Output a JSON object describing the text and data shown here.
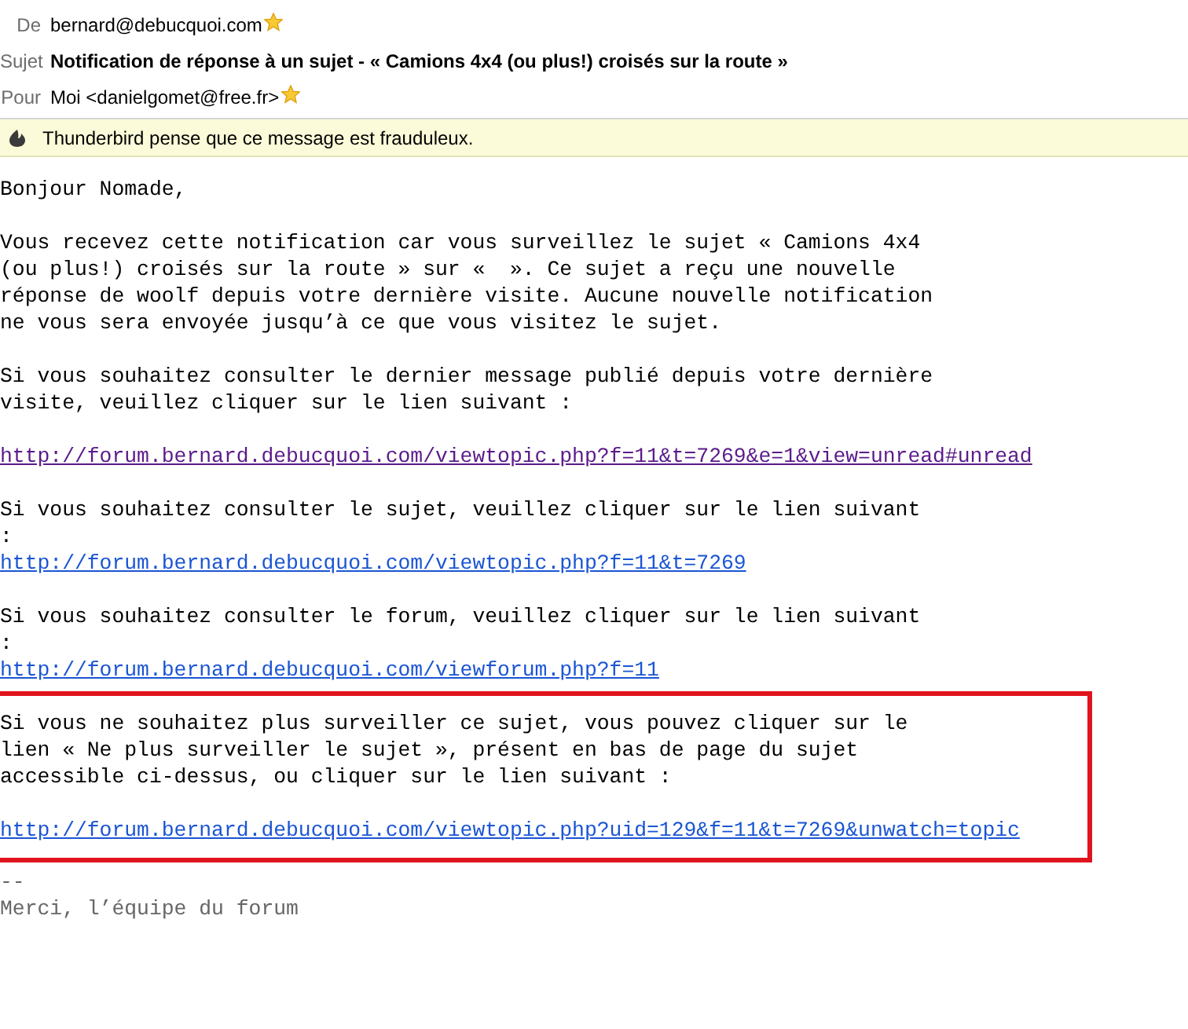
{
  "header": [
    {
      "label": "De",
      "value": "bernard@debucquoi.com",
      "bold": false,
      "starred": true
    },
    {
      "label": "Sujet",
      "value": "Notification de réponse à un sujet - « Camions 4x4 (ou plus!) croisés sur la route »",
      "bold": true,
      "starred": false
    },
    {
      "label": "Pour",
      "value": "Moi <danielgomet@free.fr>",
      "bold": false,
      "starred": true
    }
  ],
  "notification": {
    "text": "Thunderbird pense que ce message est frauduleux."
  },
  "body": [
    {
      "kind": "plain",
      "parts": [
        {
          "kind": "paragraph",
          "text": "Bonjour Nomade,"
        }
      ]
    },
    {
      "kind": "plain",
      "parts": [
        {
          "kind": "paragraph",
          "text": "Vous recevez cette notification car vous surveillez le sujet « Camions 4x4\n(ou plus!) croisés sur la route » sur «  ». Ce sujet a reçu une nouvelle\nréponse de woolf depuis votre dernière visite. Aucune nouvelle notification\nne vous sera envoyée jusqu’à ce que vous visitez le sujet."
        }
      ]
    },
    {
      "kind": "plain",
      "parts": [
        {
          "kind": "paragraph",
          "text": "Si vous souhaitez consulter le dernier message publié depuis votre dernière\nvisite, veuillez cliquer sur le lien suivant :"
        }
      ]
    },
    {
      "kind": "plain",
      "parts": [
        {
          "kind": "link",
          "text": "http://forum.bernard.debucquoi.com/viewtopic.php?f=11&t=7269&e=1&view=unread#unread",
          "visited": true
        }
      ]
    },
    {
      "kind": "plain",
      "parts": [
        {
          "kind": "paragraph",
          "text": "Si vous souhaitez consulter le sujet, veuillez cliquer sur le lien suivant\n:"
        },
        {
          "kind": "link",
          "text": "http://forum.bernard.debucquoi.com/viewtopic.php?f=11&t=7269",
          "visited": false
        }
      ]
    },
    {
      "kind": "plain",
      "parts": [
        {
          "kind": "paragraph",
          "text": "Si vous souhaitez consulter le forum, veuillez cliquer sur le lien suivant\n:"
        },
        {
          "kind": "link",
          "text": "http://forum.bernard.debucquoi.com/viewforum.php?f=11",
          "visited": false
        }
      ]
    },
    {
      "kind": "highlighted",
      "parts": [
        {
          "kind": "paragraph",
          "text": "Si vous ne souhaitez plus surveiller ce sujet, vous pouvez cliquer sur le\nlien « Ne plus surveiller le sujet », présent en bas de page du sujet\naccessible ci-dessus, ou cliquer sur le lien suivant :"
        },
        {
          "kind": "link",
          "text": "http://forum.bernard.debucquoi.com/viewtopic.php?uid=129&f=11&t=7269&unwatch=topic",
          "visited": false
        }
      ]
    },
    {
      "kind": "signature",
      "parts": [
        {
          "kind": "paragraph",
          "text": "--\nMerci, l’équipe du forum"
        }
      ]
    }
  ]
}
